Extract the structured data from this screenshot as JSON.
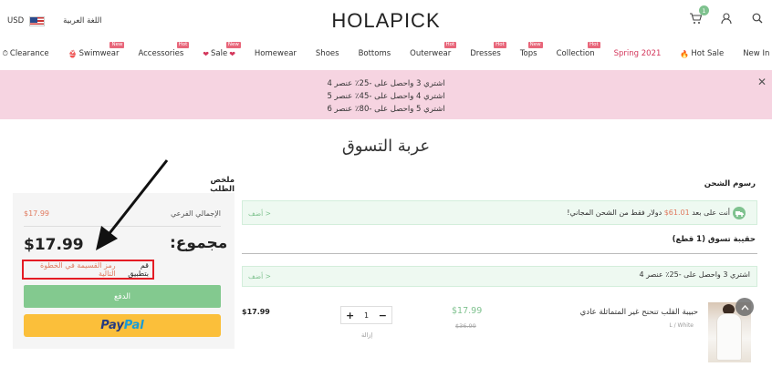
{
  "header": {
    "currency": "USD",
    "language": "اللغة العربية",
    "logo": "HOLAPICK",
    "cart_count": "1"
  },
  "nav": {
    "items": [
      {
        "label": "Clearance",
        "tag": "",
        "icon": "stopwatch-icon",
        "red": false
      },
      {
        "label": "Swimwear",
        "tag": "New",
        "icon": "bikini-icon",
        "red": false
      },
      {
        "label": "Accessories",
        "tag": "Hot",
        "icon": "",
        "red": false
      },
      {
        "label": "Sale",
        "tag": "New",
        "icon": "heart-icon",
        "red": false
      },
      {
        "label": "Homewear",
        "tag": "",
        "icon": "",
        "red": false
      },
      {
        "label": "Shoes",
        "tag": "",
        "icon": "",
        "red": false
      },
      {
        "label": "Bottoms",
        "tag": "",
        "icon": "",
        "red": false
      },
      {
        "label": "Outerwear",
        "tag": "Hot",
        "icon": "",
        "red": false
      },
      {
        "label": "Dresses",
        "tag": "Hot",
        "icon": "",
        "red": false
      },
      {
        "label": "Tops",
        "tag": "New",
        "icon": "",
        "red": false
      },
      {
        "label": "Collection",
        "tag": "Hot",
        "icon": "",
        "red": false
      },
      {
        "label": "Spring 2021",
        "tag": "",
        "icon": "",
        "red": true
      },
      {
        "label": "Hot Sale",
        "tag": "",
        "icon": "fire-icon",
        "red": false
      },
      {
        "label": "New In",
        "tag": "",
        "icon": "",
        "red": false
      }
    ]
  },
  "promo": {
    "lines": [
      "اشتري 3 واحصل على -25٪ عنصر 4",
      "اشتري 4 واحصل على -45٪ عنصر 5",
      "اشتري 5 واحصل على -80٪ عنصر 6"
    ]
  },
  "page_title": "عربة التسوق",
  "summary": {
    "heading": "ملخص الطلب",
    "subtotal_label": "الإجمالي الفرعي",
    "subtotal_value": "$17.99",
    "total_label": "مجموع:",
    "total_value": "$17.99",
    "coupon_prefix": "قم بتطبيق",
    "coupon_link": "رمز القسيمة في الخطوة التالية",
    "checkout_label": "الدفع",
    "paypal_a": "Pay",
    "paypal_b": "Pal"
  },
  "shipping": {
    "heading": "رسوم الشحن",
    "text_before": "أنت على بعد",
    "amount": "61.01$",
    "text_after": "دولار فقط من الشحن المجاني!",
    "add_label": "أضف >"
  },
  "bag": {
    "heading": "حقيبة تسوق (1 قطع)",
    "offer_text": "اشتري 3 واحصل على -25٪ عنصر 4",
    "offer_add": "أضف >"
  },
  "item": {
    "name": "حبيبة القلب تنحنح غير المتماثلة عادي",
    "variant": "L / White",
    "price": "$17.99",
    "original_price": "$36.99",
    "quantity": "1",
    "remove_label": "إزالة",
    "line_total": "$17.99"
  },
  "colors": {
    "accent_green": "#83c98f",
    "promo_pink": "#f6d4e1",
    "paypal_yellow": "#fbbf3a",
    "price_orange": "#e07a5f",
    "highlight_red": "#e41c24"
  }
}
